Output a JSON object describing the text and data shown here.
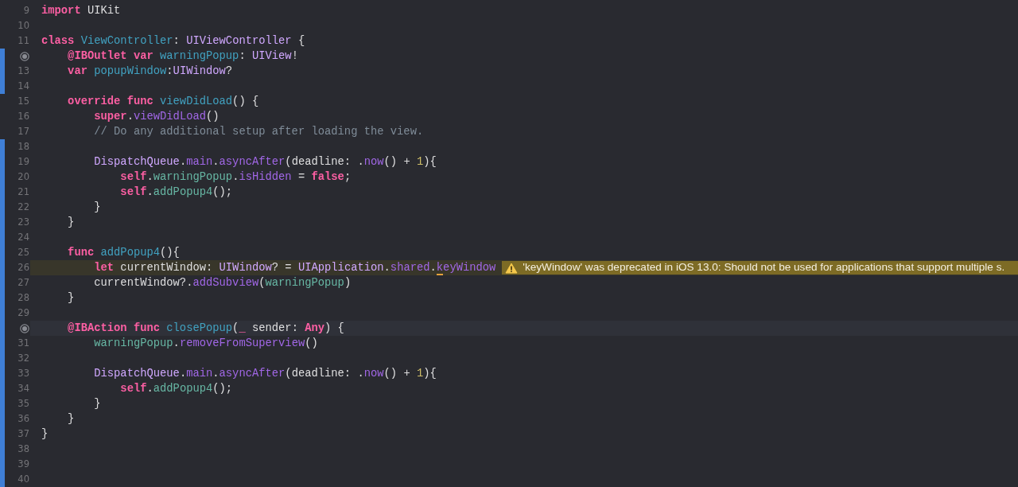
{
  "editor": {
    "lines": [
      {
        "number": "9",
        "changed": false,
        "tokens": [
          {
            "kind": "keyword",
            "text": "import"
          },
          {
            "kind": "plain",
            "text": " UIKit"
          }
        ]
      },
      {
        "number": "10",
        "changed": false
      },
      {
        "number": "11",
        "changed": false,
        "tokens": [
          {
            "kind": "keyword",
            "text": "class "
          },
          {
            "kind": "declaration",
            "text": "ViewController"
          },
          {
            "kind": "plain",
            "text": ": "
          },
          {
            "kind": "type",
            "text": "UIViewController"
          },
          {
            "kind": "plain",
            "text": " {"
          }
        ]
      },
      {
        "outlet": true,
        "changed": true,
        "tokens": [
          {
            "kind": "keyword",
            "text": "    @IBOutlet var "
          },
          {
            "kind": "declaration",
            "text": "warningPopup"
          },
          {
            "kind": "plain",
            "text": ": "
          },
          {
            "kind": "type",
            "text": "UIView"
          },
          {
            "kind": "plain",
            "text": "!"
          }
        ]
      },
      {
        "number": "13",
        "changed": true,
        "tokens": [
          {
            "kind": "keyword",
            "text": "    var "
          },
          {
            "kind": "declaration",
            "text": "popupWindow"
          },
          {
            "kind": "plain",
            "text": ":"
          },
          {
            "kind": "type",
            "text": "UIWindow"
          },
          {
            "kind": "plain",
            "text": "?"
          }
        ]
      },
      {
        "number": "14",
        "changed": true
      },
      {
        "number": "15",
        "changed": false,
        "tokens": [
          {
            "kind": "keyword",
            "text": "    override func "
          },
          {
            "kind": "declaration",
            "text": "viewDidLoad"
          },
          {
            "kind": "plain",
            "text": "() {"
          }
        ]
      },
      {
        "number": "16",
        "changed": false,
        "tokens": [
          {
            "kind": "keyword",
            "text": "        super"
          },
          {
            "kind": "plain",
            "text": "."
          },
          {
            "kind": "system",
            "text": "viewDidLoad"
          },
          {
            "kind": "plain",
            "text": "()"
          }
        ]
      },
      {
        "number": "17",
        "changed": false,
        "tokens": [
          {
            "kind": "comment",
            "text": "        // Do any additional setup after loading the view."
          }
        ]
      },
      {
        "number": "18",
        "changed": true
      },
      {
        "number": "19",
        "changed": true,
        "tokens": [
          {
            "kind": "type",
            "text": "        DispatchQueue"
          },
          {
            "kind": "plain",
            "text": "."
          },
          {
            "kind": "system",
            "text": "main"
          },
          {
            "kind": "plain",
            "text": "."
          },
          {
            "kind": "system",
            "text": "asyncAfter"
          },
          {
            "kind": "plain",
            "text": "(deadline: ."
          },
          {
            "kind": "system",
            "text": "now"
          },
          {
            "kind": "plain",
            "text": "() + "
          },
          {
            "kind": "number",
            "text": "1"
          },
          {
            "kind": "plain",
            "text": "){"
          }
        ]
      },
      {
        "number": "20",
        "changed": true,
        "tokens": [
          {
            "kind": "keyword",
            "text": "            self"
          },
          {
            "kind": "plain",
            "text": "."
          },
          {
            "kind": "project",
            "text": "warningPopup"
          },
          {
            "kind": "plain",
            "text": "."
          },
          {
            "kind": "system",
            "text": "isHidden"
          },
          {
            "kind": "plain",
            "text": " = "
          },
          {
            "kind": "keyword",
            "text": "false"
          },
          {
            "kind": "plain",
            "text": ";"
          }
        ]
      },
      {
        "number": "21",
        "changed": true,
        "tokens": [
          {
            "kind": "keyword",
            "text": "            self"
          },
          {
            "kind": "plain",
            "text": "."
          },
          {
            "kind": "project",
            "text": "addPopup4"
          },
          {
            "kind": "plain",
            "text": "();"
          }
        ]
      },
      {
        "number": "22",
        "changed": true,
        "tokens": [
          {
            "kind": "plain",
            "text": "        }"
          }
        ]
      },
      {
        "number": "23",
        "changed": true,
        "tokens": [
          {
            "kind": "plain",
            "text": "    }"
          }
        ]
      },
      {
        "number": "24",
        "changed": true
      },
      {
        "number": "25",
        "changed": true,
        "tokens": [
          {
            "kind": "keyword",
            "text": "    func "
          },
          {
            "kind": "declaration",
            "text": "addPopup4"
          },
          {
            "kind": "plain",
            "text": "(){"
          }
        ]
      },
      {
        "number": "26",
        "changed": true,
        "warning": "'keyWindow' was deprecated in iOS 13.0: Should not be used for applications that support multiple s.",
        "tokens": [
          {
            "kind": "keyword",
            "text": "        let"
          },
          {
            "kind": "plain",
            "text": " currentWindow: "
          },
          {
            "kind": "type",
            "text": "UIWindow"
          },
          {
            "kind": "plain",
            "text": "? = "
          },
          {
            "kind": "type",
            "text": "UIApplication"
          },
          {
            "kind": "plain",
            "text": "."
          },
          {
            "kind": "system",
            "text": "shared"
          },
          {
            "kind": "plain",
            "text": "."
          },
          {
            "kind": "system",
            "text": "k",
            "underlined": true
          },
          {
            "kind": "system",
            "text": "eyWindow"
          }
        ]
      },
      {
        "number": "27",
        "changed": true,
        "tokens": [
          {
            "kind": "plain",
            "text": "        currentWindow?."
          },
          {
            "kind": "system",
            "text": "addSubview"
          },
          {
            "kind": "plain",
            "text": "("
          },
          {
            "kind": "project",
            "text": "warningPopup"
          },
          {
            "kind": "plain",
            "text": ")"
          }
        ]
      },
      {
        "number": "28",
        "changed": true,
        "tokens": [
          {
            "kind": "plain",
            "text": "    }"
          }
        ]
      },
      {
        "number": "29",
        "changed": true
      },
      {
        "outlet": true,
        "changed": true,
        "current": true,
        "tokens": [
          {
            "kind": "keyword",
            "text": "    @IBAction func "
          },
          {
            "kind": "declaration",
            "text": "closePopup"
          },
          {
            "kind": "plain",
            "text": "("
          },
          {
            "kind": "keyword",
            "text": "_"
          },
          {
            "kind": "plain",
            "text": " sender: "
          },
          {
            "kind": "keyword",
            "text": "Any"
          },
          {
            "kind": "plain",
            "text": ") {"
          }
        ]
      },
      {
        "number": "31",
        "changed": true,
        "tokens": [
          {
            "kind": "project",
            "text": "        warningPopup"
          },
          {
            "kind": "plain",
            "text": "."
          },
          {
            "kind": "system",
            "text": "removeFromSuperview"
          },
          {
            "kind": "plain",
            "text": "()"
          }
        ]
      },
      {
        "number": "32",
        "changed": true
      },
      {
        "number": "33",
        "changed": true,
        "tokens": [
          {
            "kind": "type",
            "text": "        DispatchQueue"
          },
          {
            "kind": "plain",
            "text": "."
          },
          {
            "kind": "system",
            "text": "main"
          },
          {
            "kind": "plain",
            "text": "."
          },
          {
            "kind": "system",
            "text": "asyncAfter"
          },
          {
            "kind": "plain",
            "text": "(deadline: ."
          },
          {
            "kind": "system",
            "text": "now"
          },
          {
            "kind": "plain",
            "text": "() + "
          },
          {
            "kind": "number",
            "text": "1"
          },
          {
            "kind": "plain",
            "text": "){"
          }
        ]
      },
      {
        "number": "34",
        "changed": true,
        "tokens": [
          {
            "kind": "keyword",
            "text": "            self"
          },
          {
            "kind": "plain",
            "text": "."
          },
          {
            "kind": "project",
            "text": "addPopup4"
          },
          {
            "kind": "plain",
            "text": "();"
          }
        ]
      },
      {
        "number": "35",
        "changed": true,
        "tokens": [
          {
            "kind": "plain",
            "text": "        }"
          }
        ]
      },
      {
        "number": "36",
        "changed": true,
        "tokens": [
          {
            "kind": "plain",
            "text": "    }"
          }
        ]
      },
      {
        "number": "37",
        "changed": true,
        "tokens": [
          {
            "kind": "plain",
            "text": "}"
          }
        ]
      },
      {
        "number": "38",
        "changed": true
      },
      {
        "number": "39",
        "changed": true
      },
      {
        "number": "40",
        "changed": true
      }
    ]
  }
}
